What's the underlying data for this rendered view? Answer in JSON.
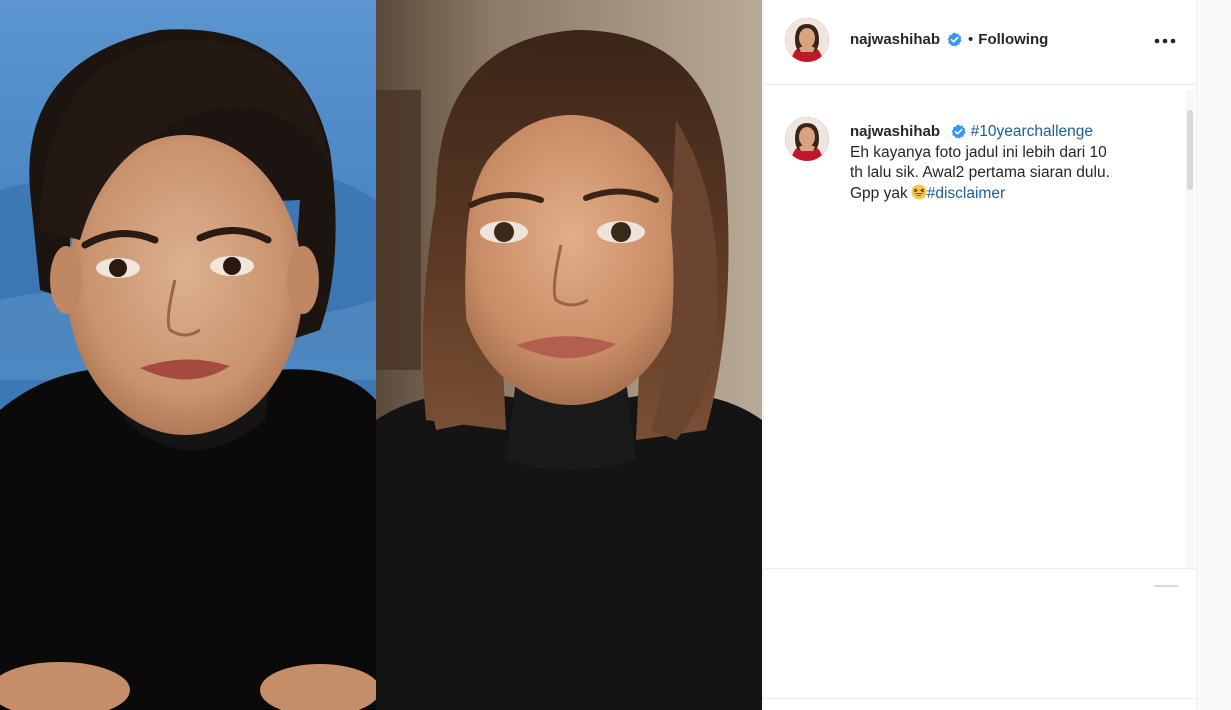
{
  "post": {
    "username": "najwashihab",
    "separator": "•",
    "follow_status": "Following",
    "more_icon": "more-horizontal-icon",
    "verified_icon": "verified-badge-icon",
    "verified_color": "#3897f0",
    "photos": [
      {
        "name": "then-photo"
      },
      {
        "name": "now-photo"
      }
    ]
  },
  "caption": {
    "username": "najwashihab",
    "hashtag": "#10yearchallenge",
    "text_line1": "Eh kayanya foto jadul ini lebih dari 10",
    "text_line2": "th lalu sik. Awal2 pertama siaran dulu.",
    "text_line3": "Gpp yak",
    "emoji_icon": "grinning-squinting-face-icon",
    "hashtag2": "#disclaimer"
  },
  "colors": {
    "link": "#1a5e9a",
    "text": "#262626",
    "border": "#efefef"
  }
}
